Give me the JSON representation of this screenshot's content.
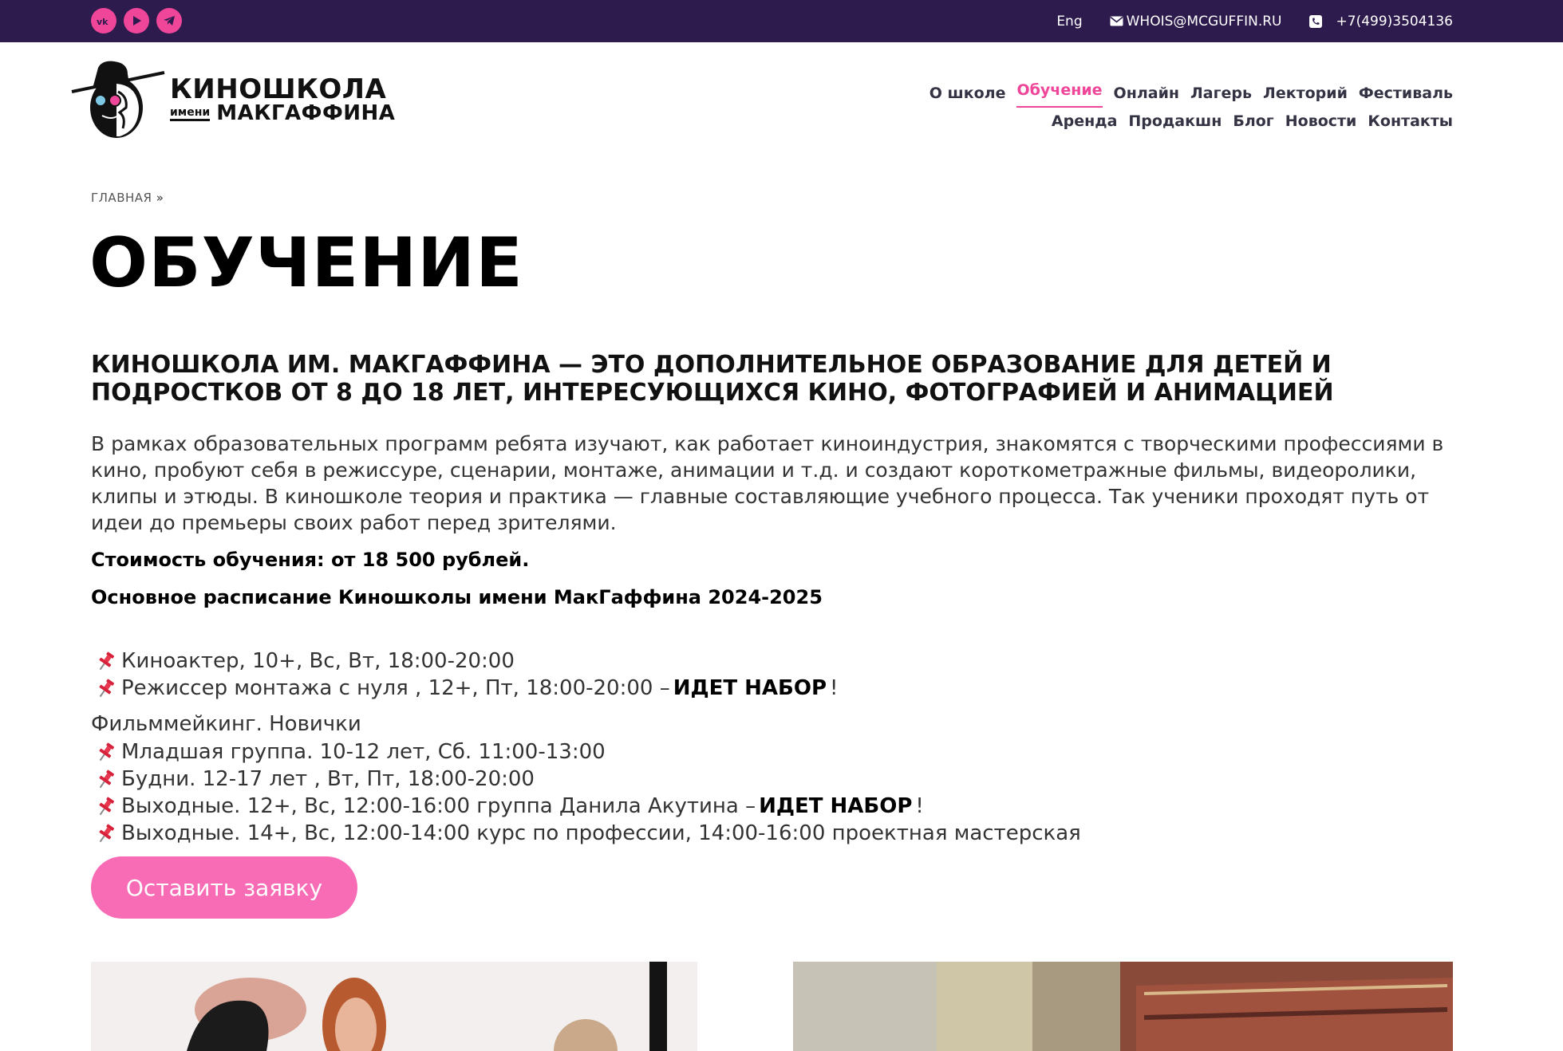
{
  "topbar": {
    "social": [
      "vk",
      "youtube",
      "telegram"
    ],
    "lang": "Eng",
    "email": "WHOIS@MCGUFFIN.RU",
    "phone": "+7(499)3504136"
  },
  "logo": {
    "line1": "КИНОШКОЛА",
    "line2_small": "имени",
    "line2_big": "МАКГАФФИНА"
  },
  "nav": {
    "row1": [
      "О школе",
      "Обучение",
      "Онлайн",
      "Лагерь",
      "Лекторий",
      "Фестиваль"
    ],
    "row2": [
      "Аренда",
      "Продакшн",
      "Блог",
      "Новости",
      "Контакты"
    ],
    "active": "Обучение"
  },
  "breadcrumb": {
    "home": "ГЛАВНАЯ",
    "sep": "»"
  },
  "page_title": "ОБУЧЕНИЕ",
  "lead": "КИНОШКОЛА ИМ. МАКГАФФИНА — ЭТО ДОПОЛНИТЕЛЬНОЕ ОБРАЗОВАНИЕ ДЛЯ ДЕТЕЙ И ПОДРОСТКОВ ОТ 8 ДО 18 ЛЕТ, ИНТЕРЕСУЮЩИХСЯ КИНО, ФОТОГРАФИЕЙ И АНИМАЦИЕЙ",
  "description": "В рамках образовательных программ ребята изучают, как работает киноиндустрия, знакомятся с творческими профессиями в кино, пробуют себя в режиссуре, сценарии, монтаже, анимации и т.д. и создают короткометражные фильмы, видеоролики, клипы и этюды. В киношколе теория и практика — главные составляющие учебного процесса. Так ученики проходят путь от идеи до премьеры своих работ перед зрителями.",
  "price": "Стоимость обучения: от 18 500 рублей.",
  "schedule_title": "Основное расписание Киношколы имени МакГаффина 2024-2025",
  "schedule_list1": [
    {
      "text": "Киноактер, 10+, Вс, Вт, 18:00-20:00",
      "badge": "",
      "tail": ""
    },
    {
      "text": "Режиссер монтажа с нуля , 12+, Пт, 18:00-20:00 – ",
      "badge": "ИДЕТ НАБОР",
      "tail": "!"
    }
  ],
  "group_title": "Фильммейкинг. Новички",
  "schedule_list2": [
    {
      "text": "Младшая группа. 10-12 лет, Сб. 11:00-13:00",
      "badge": "",
      "tail": ""
    },
    {
      "text": "Будни. 12-17 лет , Вт, Пт, 18:00-20:00",
      "badge": "",
      "tail": ""
    },
    {
      "text": "Выходные. 12+, Вс, 12:00-16:00 группа Данила Акутина – ",
      "badge": "ИДЕТ НАБОР",
      "tail": "!"
    },
    {
      "text": "Выходные. 14+, Вс, 12:00-14:00 курс по профессии, 14:00-16:00 проектная мастерская",
      "badge": "",
      "tail": ""
    }
  ],
  "cta_label": "Оставить заявку",
  "colors": {
    "topbar": "#2d1b4e",
    "accent": "#f0469a",
    "cta": "#f86cb6"
  }
}
